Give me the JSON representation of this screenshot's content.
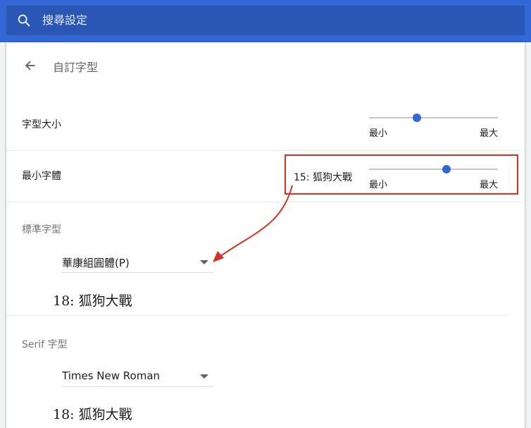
{
  "header": {
    "search": {
      "placeholder": "搜尋設定",
      "icon": "search-icon"
    }
  },
  "page": {
    "title": "自訂字型"
  },
  "font_size": {
    "label": "字型大小",
    "slider": {
      "level": 0.37,
      "min_label": "最小",
      "max_label": "最大"
    }
  },
  "minimum_font": {
    "label": "最小字體",
    "preview": "15: 狐狗大戰",
    "slider": {
      "level": 0.6,
      "min_label": "最小",
      "max_label": "最大"
    }
  },
  "standard_font": {
    "title": "標準字型",
    "selected": "華康組圓體(P)",
    "sample": "18: 狐狗大戰"
  },
  "serif_font": {
    "title": "Serif 字型",
    "selected": "Times New Roman",
    "sample": "18: 狐狗大戰"
  },
  "colors": {
    "accent": "#3367d6",
    "annotation": "#d93025"
  }
}
